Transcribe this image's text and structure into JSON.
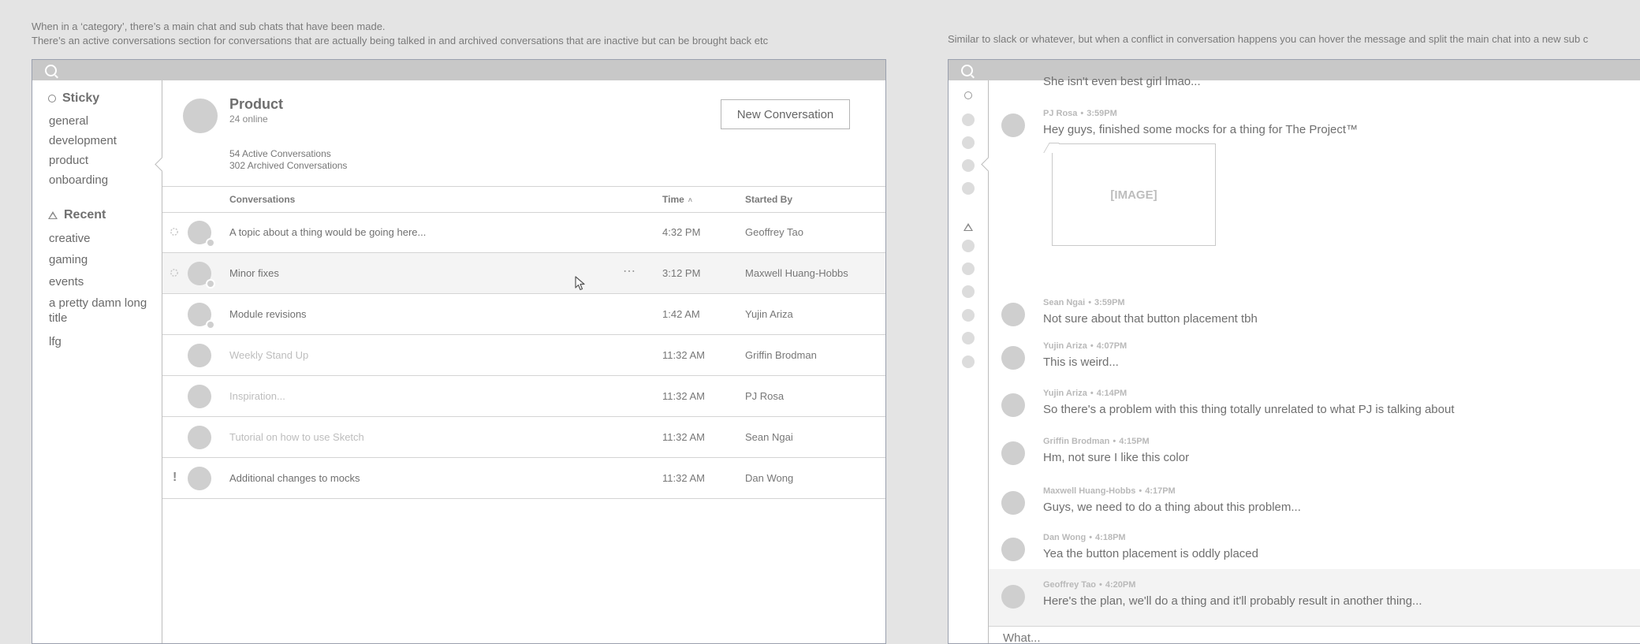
{
  "notes": {
    "left_line1": "When in a ‘category’, there’s a main chat and sub chats that have been made.",
    "left_line2": "There’s an active conversations section for conversations that are actually being talked in and archived conversations that are inactive but can be brought back etc",
    "right_line1": "Similar to slack or whatever, but when a conflict in conversation happens you can hover the message and split the main chat into a new sub c"
  },
  "sidebar": {
    "sticky_label": "Sticky",
    "sticky_items": [
      "general",
      "development",
      "product",
      "onboarding"
    ],
    "recent_label": "Recent",
    "recent_items": [
      "creative",
      "gaming",
      "events",
      "a pretty damn long title",
      "lfg"
    ],
    "icons": {
      "sticky": "circle-icon",
      "recent": "triangle-icon"
    }
  },
  "channel": {
    "title": "Product",
    "online": "24 online",
    "active": "54 Active Conversations",
    "archived": "302 Archived Conversations",
    "new_button": "New Conversation"
  },
  "table": {
    "headers": {
      "conversations": "Conversations",
      "time": "Time",
      "started_by": "Started By"
    },
    "sort_icon": "sort-asc-icon",
    "rows": [
      {
        "title": "A topic about a thing would be going here...",
        "time": "4:32 PM",
        "started_by": "Geoffrey Tao",
        "dim": false,
        "marker": "flag",
        "online": true
      },
      {
        "title": "Minor fixes",
        "time": "3:12 PM",
        "started_by": "Maxwell Huang-Hobbs",
        "dim": false,
        "marker": "flag",
        "online": true,
        "hover": true
      },
      {
        "title": "Module revisions",
        "time": "1:42 AM",
        "started_by": "Yujin Ariza",
        "dim": false,
        "marker": "",
        "online": true
      },
      {
        "title": "Weekly Stand Up",
        "time": "11:32 AM",
        "started_by": "Griffin Brodman",
        "dim": true,
        "marker": "",
        "online": false
      },
      {
        "title": "Inspiration...",
        "time": "11:32 AM",
        "started_by": "PJ Rosa",
        "dim": true,
        "marker": "",
        "online": false
      },
      {
        "title": "Tutorial on how to use Sketch",
        "time": "11:32 AM",
        "started_by": "Sean Ngai",
        "dim": true,
        "marker": "",
        "online": false
      },
      {
        "title": "Additional changes to mocks",
        "time": "11:32 AM",
        "started_by": "Dan Wong",
        "dim": false,
        "marker": "alert",
        "online": false
      }
    ]
  },
  "chat": {
    "cut_text": "She isn't even best girl lmao...",
    "image_placeholder": "[IMAGE]",
    "messages": [
      {
        "author": "PJ Rosa",
        "time": "3:59PM",
        "text": "Hey guys, finished some mocks for a thing for The Project™"
      },
      {
        "author": "Sean Ngai",
        "time": "3:59PM",
        "text": "Not sure about that button placement tbh"
      },
      {
        "author": "Yujin Ariza",
        "time": "4:07PM",
        "text": "This is weird..."
      },
      {
        "author": "Yujin Ariza",
        "time": "4:14PM",
        "text": "So there's a problem with this thing totally unrelated to what PJ is talking about"
      },
      {
        "author": "Griffin Brodman",
        "time": "4:15PM",
        "text": "Hm, not sure I like this color"
      },
      {
        "author": "Maxwell Huang-Hobbs",
        "time": "4:17PM",
        "text": "Guys, we need to do a thing about this problem..."
      },
      {
        "author": "Dan Wong",
        "time": "4:18PM",
        "text": "Yea the button placement is oddly placed"
      },
      {
        "author": "Geoffrey Tao",
        "time": "4:20PM",
        "text": "Here's the plan, we'll do a thing and it'll probably result in another thing..."
      }
    ],
    "composer_placeholder": "What..."
  }
}
